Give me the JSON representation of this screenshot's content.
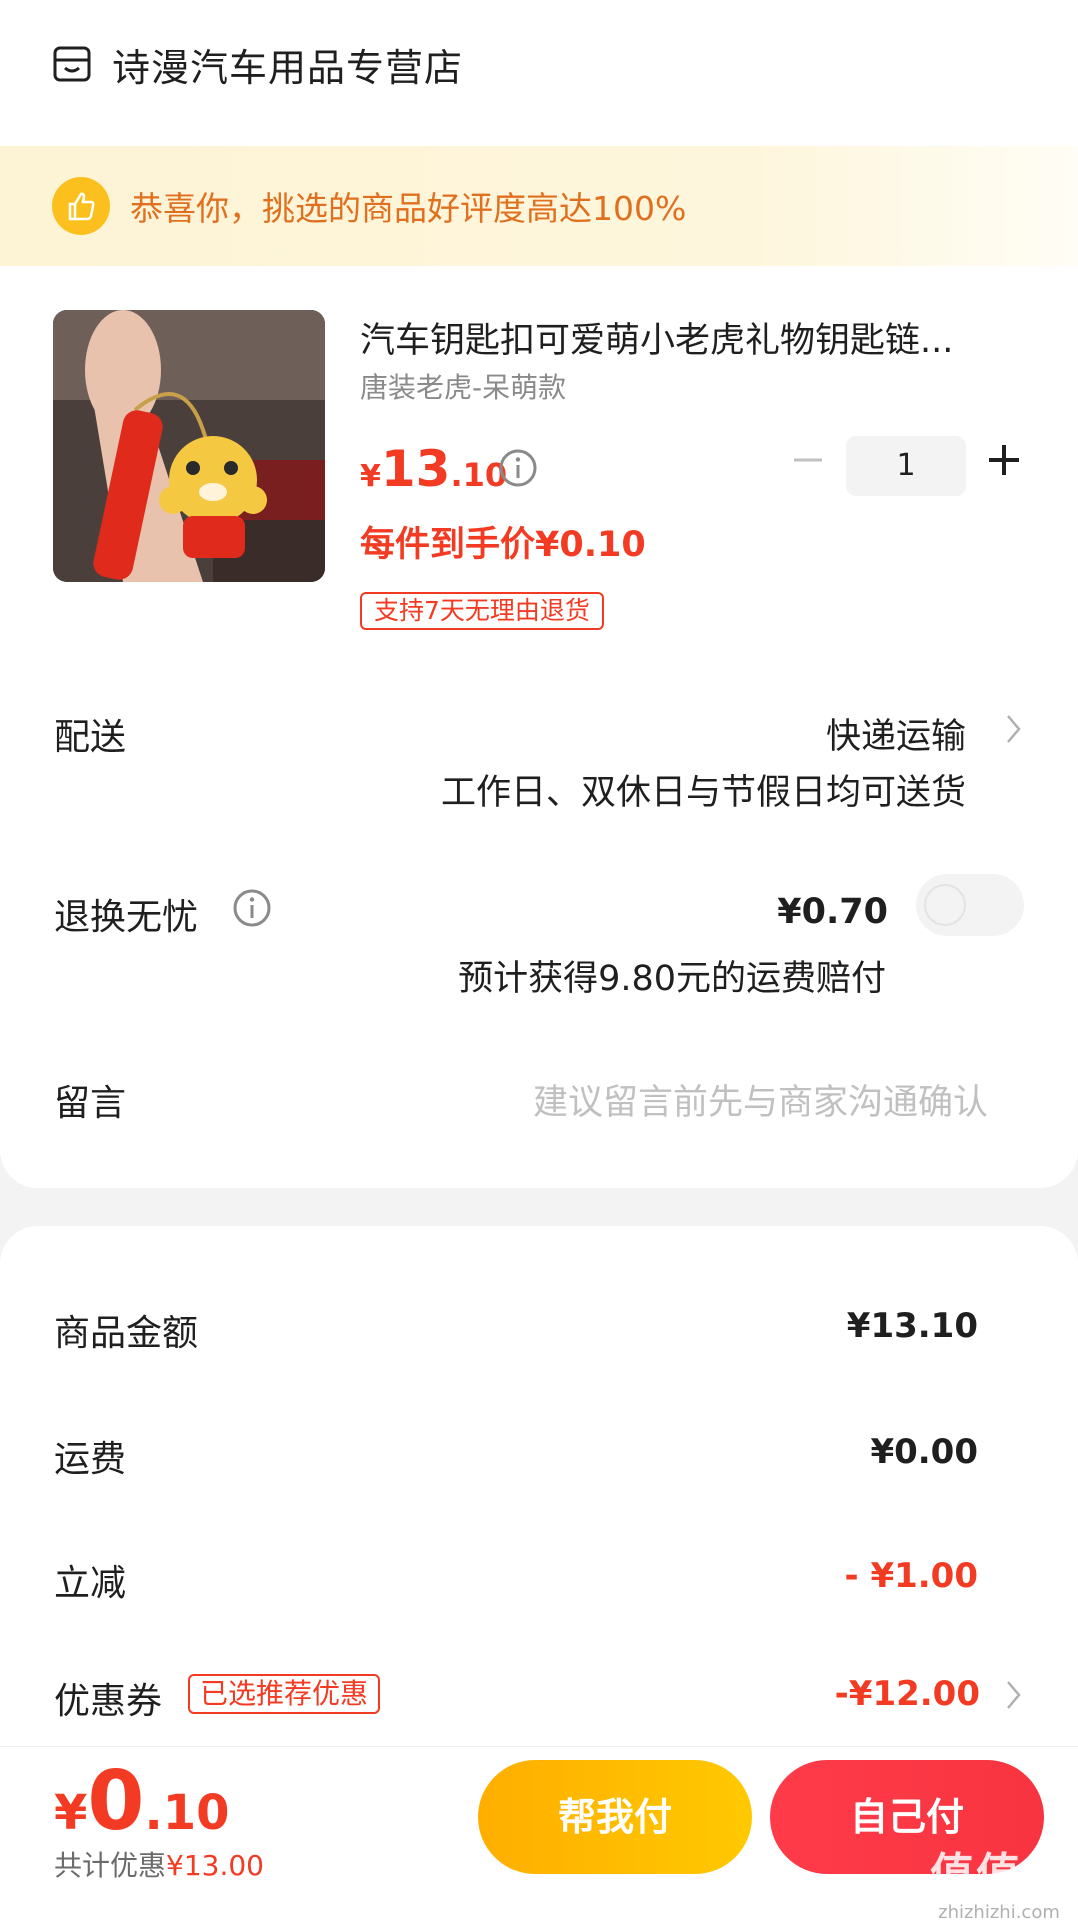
{
  "store": {
    "name": "诗漫汽车用品专营店"
  },
  "banner": {
    "text": "恭喜你，挑选的商品好评度高达100%"
  },
  "product": {
    "title": "汽车钥匙扣可爱萌小老虎礼物钥匙链...",
    "variant": "唐装老虎-呆萌款",
    "price_symbol": "¥",
    "price_int": "13",
    "price_dec": ".10",
    "unit_price": "每件到手价¥0.10",
    "return_badge": "支持7天无理由退货",
    "quantity": "1"
  },
  "delivery": {
    "label": "配送",
    "method": "快递运输",
    "note": "工作日、双休日与节假日均可送货"
  },
  "return_insurance": {
    "label": "退换无忧",
    "price": "¥0.70",
    "note": "预计获得9.80元的运费赔付"
  },
  "message": {
    "label": "留言",
    "placeholder": "建议留言前先与商家沟通确认"
  },
  "summary": {
    "goods_label": "商品金额",
    "goods_value": "¥13.10",
    "shipping_label": "运费",
    "shipping_value": "¥0.00",
    "discount_label": "立减",
    "discount_value": "- ¥1.00",
    "coupon_label": "优惠券",
    "coupon_badge": "已选推荐优惠",
    "coupon_value": "-¥12.00"
  },
  "footer": {
    "total_symbol": "¥",
    "total_int": "0",
    "total_dec": ".10",
    "saved_prefix": "共计优惠",
    "saved_value": "¥13.00",
    "help_pay": "帮我付",
    "self_pay": "自己付"
  },
  "watermark": {
    "big": "值值值",
    "small": "zhizhizhi.com"
  },
  "colors": {
    "accent_red": "#f23b22",
    "banner_orange": "#e0701f",
    "help_btn": "#ffae00",
    "self_btn": "#ff3b4a"
  }
}
